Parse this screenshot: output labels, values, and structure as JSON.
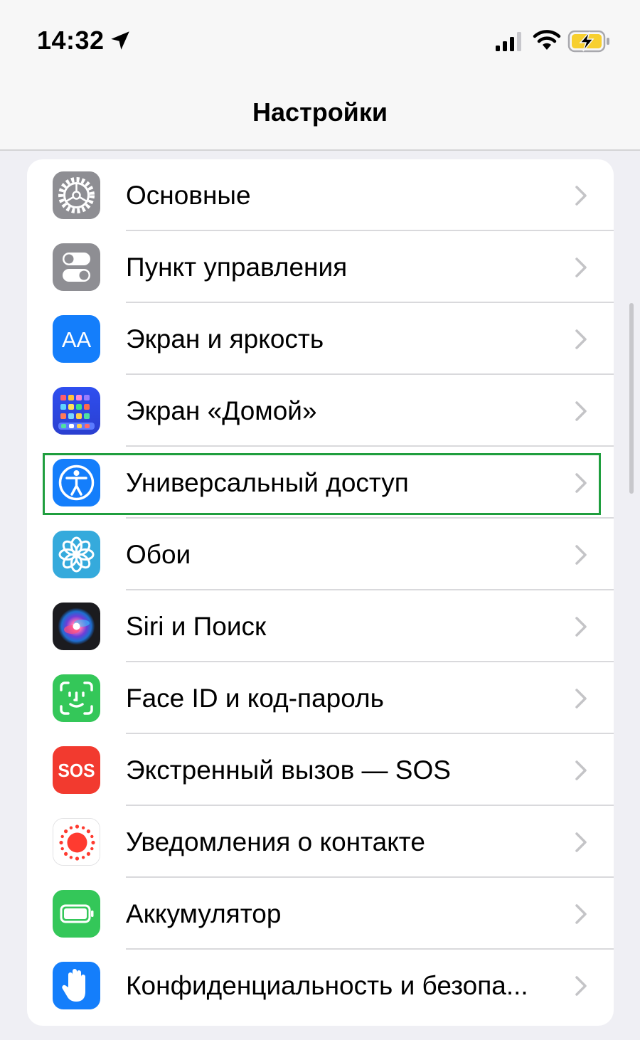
{
  "status_bar": {
    "time": "14:32",
    "icons": [
      "location-arrow-icon",
      "cellular-signal-icon",
      "wifi-icon",
      "battery-charging-icon"
    ]
  },
  "nav": {
    "title": "Настройки"
  },
  "settings": {
    "items": [
      {
        "label": "Основные",
        "icon": "gear-icon",
        "icon_color": "#8e8e93"
      },
      {
        "label": "Пункт управления",
        "icon": "toggles-icon",
        "icon_color": "#8e8e93"
      },
      {
        "label": "Экран и яркость",
        "icon": "text-size-icon",
        "icon_glyph": "AA",
        "icon_color": "#147efb"
      },
      {
        "label": "Экран «Домой»",
        "icon": "home-screen-grid-icon",
        "icon_color": "#2c4fe8"
      },
      {
        "label": "Универсальный доступ",
        "icon": "accessibility-icon",
        "icon_color": "#147efb",
        "highlighted": true
      },
      {
        "label": "Обои",
        "icon": "flower-icon",
        "icon_color": "#35aadc"
      },
      {
        "label": "Siri и Поиск",
        "icon": "siri-icon",
        "icon_color": "#1b1b1f"
      },
      {
        "label": "Face ID и код-пароль",
        "icon": "face-id-icon",
        "icon_color": "#34c759"
      },
      {
        "label": "Экстренный вызов — SOS",
        "icon": "sos-icon",
        "icon_glyph": "SOS",
        "icon_color": "#f23a2f"
      },
      {
        "label": "Уведомления о контакте",
        "icon": "exposure-notification-icon",
        "icon_color": "#ff3b30"
      },
      {
        "label": "Аккумулятор",
        "icon": "battery-icon",
        "icon_color": "#34c759"
      },
      {
        "label": "Конфиденциальность и безопа...",
        "icon": "privacy-hand-icon",
        "icon_color": "#147efb"
      }
    ]
  },
  "highlight_color": "#1f9e3e"
}
